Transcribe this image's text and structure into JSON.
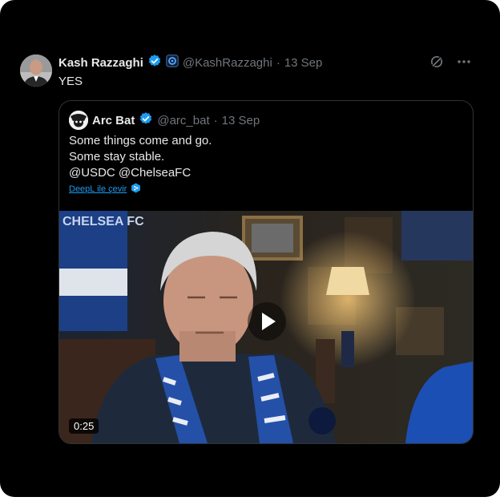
{
  "tweet": {
    "author_name": "Kash Razzaghi",
    "handle": "@KashRazzaghi",
    "separator": "·",
    "date": "13 Sep",
    "text": "YES",
    "verified_icon": "verified-badge-icon",
    "affiliate_icon": "affiliate-badge-icon"
  },
  "top_actions": {
    "grok_icon": "grok-icon",
    "more_icon": "more-icon"
  },
  "quoted": {
    "author_name": "Arc Bat",
    "handle": "@arc_bat",
    "separator": "·",
    "date": "13 Sep",
    "lines": [
      "Some things come and go.",
      "Some stay stable.",
      "@USDC @ChelseaFC"
    ],
    "translate_link": "DeepL ile çevir",
    "video": {
      "duration": "0:25",
      "banner_text": "CHELSEA FC"
    }
  },
  "colors": {
    "background": "#000000",
    "text": "#e7e9ea",
    "muted": "#71767b",
    "accent": "#1d9bf0",
    "border": "#2f3336"
  }
}
